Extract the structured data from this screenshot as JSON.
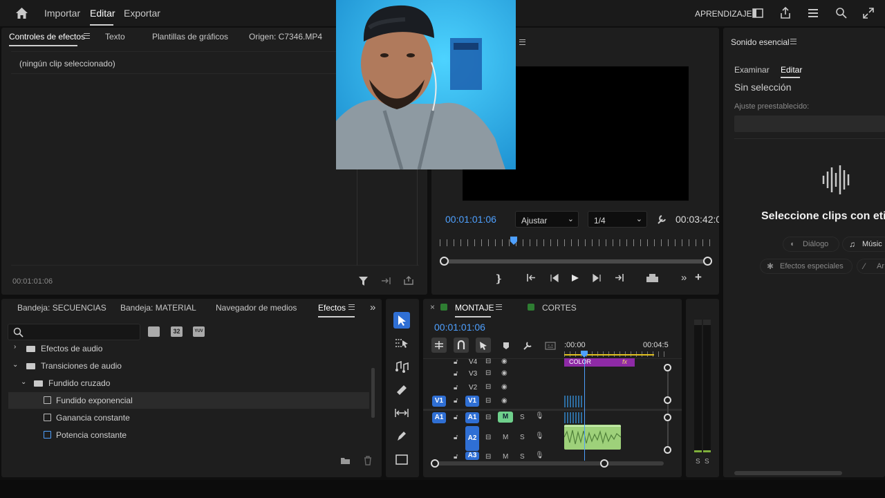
{
  "header": {
    "home_icon": "home-icon",
    "nav": [
      "Importar",
      "Editar",
      "Exportar"
    ],
    "active_nav": "Editar",
    "learning": "APRENDIZAJE",
    "right_icons": [
      "panel-icon",
      "share-icon",
      "menu-lines-icon",
      "search-icon",
      "fullscreen-icon"
    ]
  },
  "effect_controls": {
    "tabs": [
      "Controles de efectos",
      "Texto",
      "Plantillas de gráficos",
      "Origen: C7346.MP4"
    ],
    "empty_text": "(ningún clip seleccionado)",
    "timecode": "00:01:01:06"
  },
  "program_monitor": {
    "timecode": "00:01:01:06",
    "fit_label": "Ajustar",
    "quality_label": "1/4",
    "duration": "00:03:42:0"
  },
  "essential_sound": {
    "title": "Sonido esencial",
    "tabs": [
      "Examinar",
      "Editar"
    ],
    "active_tab": "Editar",
    "no_selection": "Sin selección",
    "preset_label": "Ajuste preestablecido:",
    "select_clips": "Seleccione clips con eti",
    "types": [
      "Diálogo",
      "Músic",
      "Efectos especiales",
      "Ar"
    ]
  },
  "project_panel": {
    "tabs": [
      "Bandeja: SECUENCIAS",
      "Bandeja: MATERIAL",
      "Navegador de medios",
      "Efectos"
    ],
    "active_tab": "Efectos",
    "tree": [
      {
        "label": "Efectos de audio",
        "indent": 0,
        "kind": "folder"
      },
      {
        "label": "Transiciones de audio",
        "indent": 0,
        "kind": "folder"
      },
      {
        "label": "Fundido cruzado",
        "indent": 1,
        "kind": "folder"
      },
      {
        "label": "Fundido exponencial",
        "indent": 2,
        "kind": "fx"
      },
      {
        "label": "Ganancia constante",
        "indent": 2,
        "kind": "fx"
      },
      {
        "label": "Potencia constante",
        "indent": 2,
        "kind": "fx"
      }
    ],
    "badge_32": "32",
    "badge_yuv": "YUV"
  },
  "timeline": {
    "sequences": [
      "MONTAJE",
      "CORTES"
    ],
    "active_sequence": "MONTAJE",
    "timecode": "00:01:01:06",
    "ruler_start": ":00:00",
    "ruler_end": "00:04:5",
    "video_tracks": [
      "V4",
      "V3",
      "V2",
      "V1"
    ],
    "audio_tracks": [
      "A1",
      "A2",
      "A3"
    ],
    "source_v": "V1",
    "source_a": "A1",
    "clip_label": "COLOR",
    "clip_fx": "fx",
    "mute": "M",
    "solo": "S"
  },
  "meter": {
    "labels": [
      "S",
      "S"
    ]
  },
  "colors": {
    "accent_blue": "#4ea0ff",
    "track_blue": "#2f6fd4",
    "clip_purple": "#9b2fb8",
    "audio_green": "#9ed17a",
    "webcam_bg": "#2bb6ee"
  }
}
